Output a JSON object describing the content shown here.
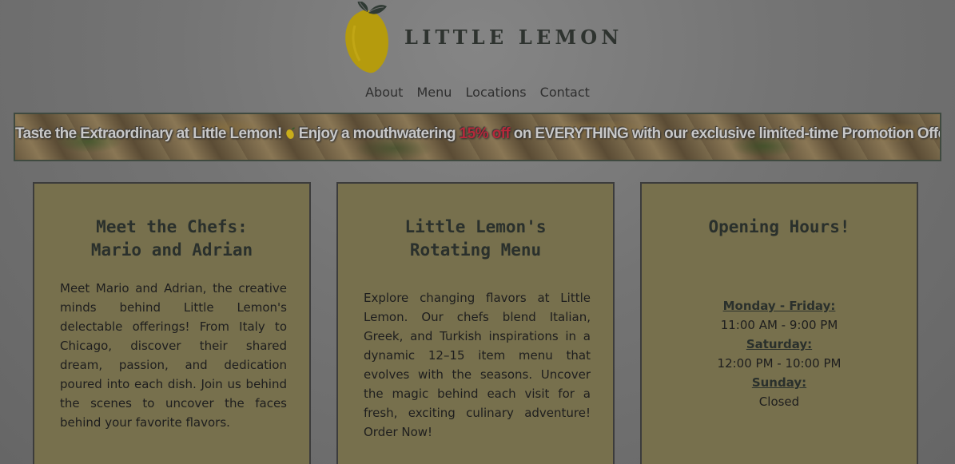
{
  "brand": {
    "name": "LITTLE LEMON",
    "logo_icon": "lemon-icon",
    "colors": {
      "lemon": "#b59b0d",
      "leaf": "#2f3a34",
      "card": "#77704d",
      "highlight": "#b5293a"
    }
  },
  "nav": {
    "items": [
      "About",
      "Menu",
      "Locations",
      "Contact"
    ]
  },
  "promo": {
    "text_start": "Taste the Extraordinary at Little Lemon!",
    "text_middle": "Enjoy a mouthwatering",
    "highlight": "15% off",
    "text_end": "on EVERYTHING with our exclusive limited-time Promotion Offer."
  },
  "cards": {
    "chefs": {
      "title_line1": "Meet the Chefs:",
      "title_line2": "Mario and Adrian",
      "body": "Meet Mario and Adrian, the creative minds behind Little Lemon's delectable offerings! From Italy to Chicago, discover their shared dream, passion, and dedication poured into each dish. Join us behind the scenes to uncover the faces behind your favorite flavors."
    },
    "menu": {
      "title_line1": "Little Lemon's",
      "title_line2": "Rotating Menu",
      "body": "Explore changing flavors at Little Lemon. Our chefs blend Italian, Greek, and Turkish inspirations in a dynamic 12–15 item menu that evolves with the seasons. Uncover the magic behind each visit for a fresh, exciting culinary adventure! Order Now!"
    },
    "hours": {
      "title": "Opening Hours!",
      "entries": [
        {
          "day": "Monday - Friday:",
          "time": "11:00 AM - 9:00 PM"
        },
        {
          "day": "Saturday:",
          "time": "12:00 PM - 10:00 PM"
        },
        {
          "day": "Sunday:",
          "time": "Closed"
        }
      ]
    }
  }
}
